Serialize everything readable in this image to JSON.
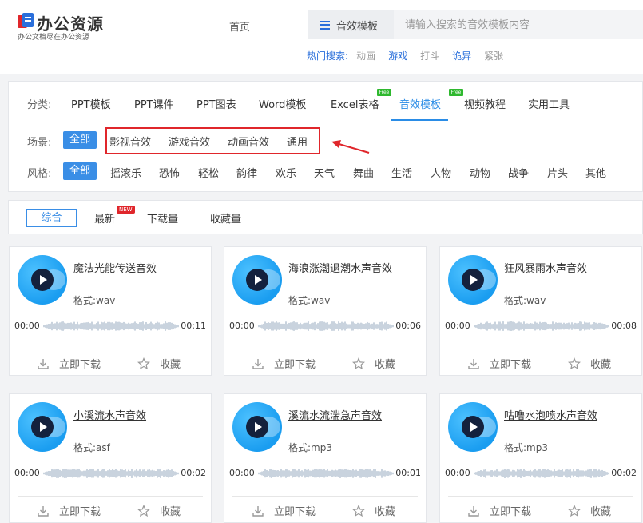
{
  "header": {
    "logo_title": "办公资源",
    "logo_subtitle": "办公文档尽在办公资源",
    "nav_home": "首页",
    "search_category": "音效模板",
    "search_placeholder": "请输入搜索的音效模板内容",
    "hot_label": "热门搜索:",
    "hot_terms": [
      {
        "label": "动画",
        "color": "#999999"
      },
      {
        "label": "游戏",
        "color": "#2a6fdb"
      },
      {
        "label": "打斗",
        "color": "#999999"
      },
      {
        "label": "诡异",
        "color": "#2a6fdb"
      },
      {
        "label": "紧张",
        "color": "#999999"
      }
    ]
  },
  "filter": {
    "category_label": "分类:",
    "categories": [
      {
        "label": "PPT模板",
        "active": false,
        "badge": ""
      },
      {
        "label": "PPT课件",
        "active": false,
        "badge": ""
      },
      {
        "label": "PPT图表",
        "active": false,
        "badge": ""
      },
      {
        "label": "Word模板",
        "active": false,
        "badge": ""
      },
      {
        "label": "Excel表格",
        "active": false,
        "badge": "Free"
      },
      {
        "label": "音效模板",
        "active": true,
        "badge": "Free"
      },
      {
        "label": "视频教程",
        "active": false,
        "badge": ""
      },
      {
        "label": "实用工具",
        "active": false,
        "badge": ""
      }
    ],
    "scene_label": "场景:",
    "scenes": [
      "全部",
      "影视音效",
      "游戏音效",
      "动画音效",
      "通用"
    ],
    "style_label": "风格:",
    "styles": [
      "全部",
      "摇滚乐",
      "恐怖",
      "轻松",
      "韵律",
      "欢乐",
      "天气",
      "舞曲",
      "生活",
      "人物",
      "动物",
      "战争",
      "片头",
      "其他"
    ]
  },
  "sort": {
    "items": [
      "综合",
      "最新",
      "下载量",
      "收藏量"
    ],
    "active": "综合",
    "new_badge": "NEW"
  },
  "cards": [
    {
      "title": "魔法光能传送音效",
      "format": "格式:wav",
      "start": "00:00",
      "end": "00:11"
    },
    {
      "title": "海浪涨潮退潮水声音效",
      "format": "格式:wav",
      "start": "00:00",
      "end": "00:06"
    },
    {
      "title": "狂风暴雨水声音效",
      "format": "格式:wav",
      "start": "00:00",
      "end": "00:08"
    },
    {
      "title": "小溪流水声音效",
      "format": "格式:asf",
      "start": "00:00",
      "end": "00:02"
    },
    {
      "title": "溪流水流湍急声音效",
      "format": "格式:mp3",
      "start": "00:00",
      "end": "00:01"
    },
    {
      "title": "咕噜水泡喷水声音效",
      "format": "格式:mp3",
      "start": "00:00",
      "end": "00:02"
    }
  ],
  "card_actions": {
    "download": "立即下载",
    "favorite": "收藏"
  },
  "colors": {
    "accent": "#3a8ee6",
    "highlight": "#e0262b",
    "free_badge": "#2eb82e"
  }
}
